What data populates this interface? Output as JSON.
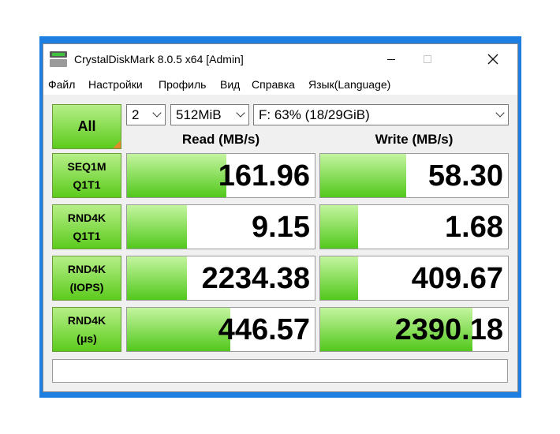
{
  "window": {
    "title": "CrystalDiskMark 8.0.5 x64 [Admin]"
  },
  "menu": {
    "items": [
      "Файл",
      "Настройки",
      "Профиль",
      "Вид",
      "Справка",
      "Язык(Language)"
    ]
  },
  "controls": {
    "all_label": "All",
    "count": "2",
    "size": "512MiB",
    "drive": "F: 63% (18/29GiB)"
  },
  "headers": {
    "read": "Read (MB/s)",
    "write": "Write (MB/s)"
  },
  "rows": [
    {
      "line1": "SEQ1M",
      "line2": "Q1T1",
      "read": "161.96",
      "write": "58.30",
      "read_fill": 0.53,
      "write_fill": 0.46
    },
    {
      "line1": "RND4K",
      "line2": "Q1T1",
      "read": "9.15",
      "write": "1.68",
      "read_fill": 0.32,
      "write_fill": 0.2
    },
    {
      "line1": "RND4K",
      "line2": "(IOPS)",
      "read": "2234.38",
      "write": "409.67",
      "read_fill": 0.32,
      "write_fill": 0.2
    },
    {
      "line1": "RND4K",
      "line2": "(μs)",
      "read": "446.57",
      "write": "2390.18",
      "read_fill": 0.55,
      "write_fill": 0.81
    }
  ],
  "status_text": "",
  "colors": {
    "accent_blue": "#1f7fe0",
    "bar_green": "#52c81c",
    "corner_orange": "#e08a2a"
  }
}
